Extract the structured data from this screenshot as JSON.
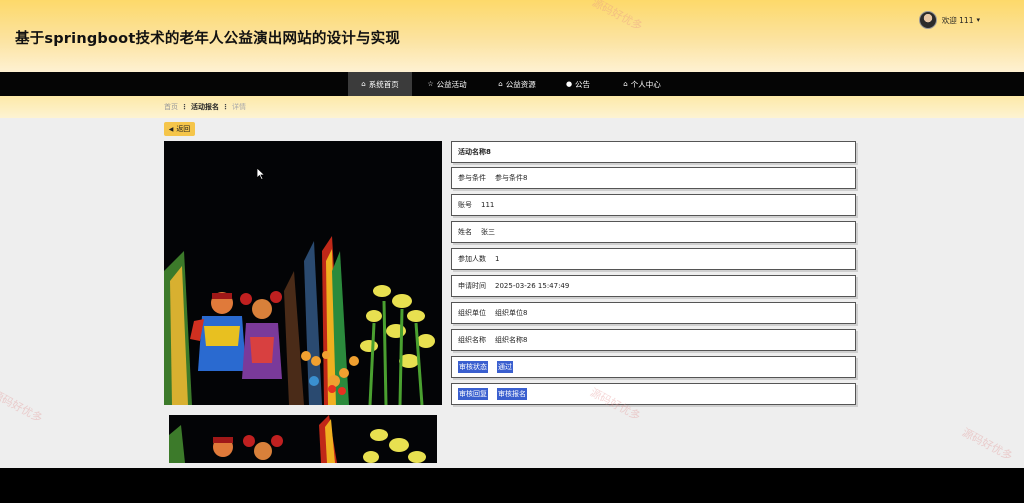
{
  "site": {
    "title": "基于springboot技术的老年人公益演出网站的设计与实现"
  },
  "user": {
    "welcome": "欢迎 111",
    "caret": "▾"
  },
  "nav": {
    "items": [
      {
        "label": "系统首页",
        "icon": "home-icon",
        "active": true
      },
      {
        "label": "公益活动",
        "icon": "star-icon",
        "active": false
      },
      {
        "label": "公益资源",
        "icon": "home-icon",
        "active": false
      },
      {
        "label": "公告",
        "icon": "info-icon",
        "active": false
      },
      {
        "label": "个人中心",
        "icon": "home-icon",
        "active": false
      }
    ]
  },
  "breadcrumb": {
    "home": "首页",
    "current": "活动报名",
    "detail": "详情",
    "sep": "⋮"
  },
  "back": {
    "label": "返回"
  },
  "detail": {
    "title": "活动名称8",
    "fields": [
      {
        "label": "参与条件",
        "value": "参与条件8"
      },
      {
        "label": "账号",
        "value": "111"
      },
      {
        "label": "姓名",
        "value": "张三"
      },
      {
        "label": "参加人数",
        "value": "1"
      },
      {
        "label": "申请时间",
        "value": "2025-03-26 15:47:49"
      },
      {
        "label": "组织单位",
        "value": "组织单位8"
      },
      {
        "label": "组织名称",
        "value": "组织名称8"
      },
      {
        "label": "审核状态",
        "value": "通过"
      },
      {
        "label": "审核回复",
        "value": "审核报名"
      }
    ]
  },
  "watermark": "源码好优多",
  "colors": {
    "accent": "#f5c54a",
    "nav_bg": "#050505",
    "selection": "#3a5fcf"
  }
}
